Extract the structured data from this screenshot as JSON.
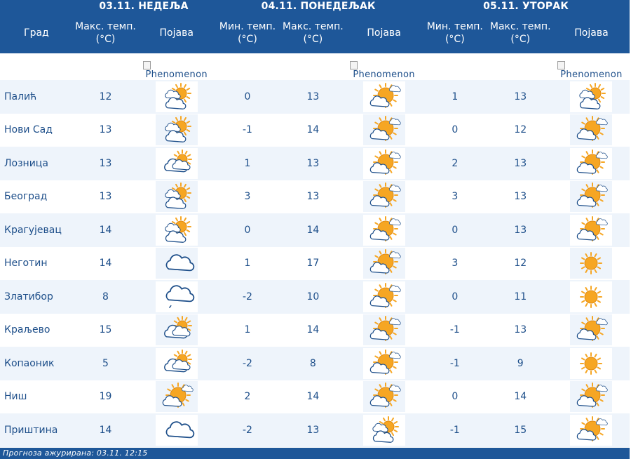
{
  "header": {
    "city_label": "Град",
    "days": [
      {
        "date": "03.11. НЕДЕЉА",
        "cols": [
          "Макс. темп. (°C)",
          "Појава"
        ]
      },
      {
        "date": "04.11. ПОНЕДЕЉАК",
        "cols": [
          "Мин. темп. (°C)",
          "Макс. темп. (°C)",
          "Појава"
        ]
      },
      {
        "date": "05.11. УТОРАК",
        "cols": [
          "Мин. темп. (°C)",
          "Макс. темп. (°C)",
          "Појава"
        ]
      }
    ],
    "broken_image_alt": "Phenomenon"
  },
  "rows": [
    {
      "city": "Палић",
      "d1max": "12",
      "d1icon": "partly-cloudy-icon",
      "d2min": "0",
      "d2max": "13",
      "d2icon": "sun-cloud-icon",
      "d3min": "1",
      "d3max": "13",
      "d3icon": "partly-cloudy-icon"
    },
    {
      "city": "Нови Сад",
      "d1max": "13",
      "d1icon": "partly-cloudy-icon",
      "d2min": "-1",
      "d2max": "14",
      "d2icon": "sun-cloud-icon",
      "d3min": "0",
      "d3max": "12",
      "d3icon": "sun-cloud-icon"
    },
    {
      "city": "Лозница",
      "d1max": "13",
      "d1icon": "cloudy-sun-icon",
      "d2min": "1",
      "d2max": "13",
      "d2icon": "sun-cloud-icon",
      "d3min": "2",
      "d3max": "13",
      "d3icon": "sun-cloud-icon"
    },
    {
      "city": "Београд",
      "d1max": "13",
      "d1icon": "partly-cloudy-icon",
      "d2min": "3",
      "d2max": "13",
      "d2icon": "sun-cloud-icon",
      "d3min": "3",
      "d3max": "13",
      "d3icon": "sun-cloud-icon"
    },
    {
      "city": "Крагујевац",
      "d1max": "14",
      "d1icon": "partly-cloudy-icon",
      "d2min": "0",
      "d2max": "14",
      "d2icon": "sun-cloud-icon",
      "d3min": "0",
      "d3max": "13",
      "d3icon": "sun-cloud-icon"
    },
    {
      "city": "Неготин",
      "d1max": "14",
      "d1icon": "cloud-icon",
      "d2min": "1",
      "d2max": "17",
      "d2icon": "sun-cloud-icon",
      "d3min": "3",
      "d3max": "12",
      "d3icon": "sun-icon"
    },
    {
      "city": "Златибор",
      "d1max": "8",
      "d1icon": "cloud-drizzle-icon",
      "d2min": "-2",
      "d2max": "10",
      "d2icon": "sun-cloud-icon",
      "d3min": "0",
      "d3max": "11",
      "d3icon": "sun-icon"
    },
    {
      "city": "Краљево",
      "d1max": "15",
      "d1icon": "cloudy-sun-icon",
      "d2min": "1",
      "d2max": "14",
      "d2icon": "sun-cloud-icon",
      "d3min": "-1",
      "d3max": "13",
      "d3icon": "sun-cloud-icon"
    },
    {
      "city": "Копаоник",
      "d1max": "5",
      "d1icon": "cloudy-sun-icon",
      "d2min": "-2",
      "d2max": "8",
      "d2icon": "sun-cloud-icon",
      "d3min": "-1",
      "d3max": "9",
      "d3icon": "sun-icon"
    },
    {
      "city": "Ниш",
      "d1max": "19",
      "d1icon": "sun-cloud-icon",
      "d2min": "2",
      "d2max": "14",
      "d2icon": "sun-cloud-icon",
      "d3min": "0",
      "d3max": "14",
      "d3icon": "sun-cloud-icon"
    },
    {
      "city": "Приштина",
      "d1max": "14",
      "d1icon": "cloud-icon",
      "d2min": "-2",
      "d2max": "13",
      "d2icon": "partly-cloudy-icon",
      "d3min": "-1",
      "d3max": "15",
      "d3icon": "sun-cloud-icon"
    }
  ],
  "footer": {
    "text": "Прогноза ажурирана:  03.11.  12:15"
  },
  "colors": {
    "header_bg": "#1e5799",
    "text": "#1e4f8a",
    "row_alt": "#eef4fb",
    "sun": "#f6a623",
    "cloud_stroke": "#1e4f8a"
  }
}
